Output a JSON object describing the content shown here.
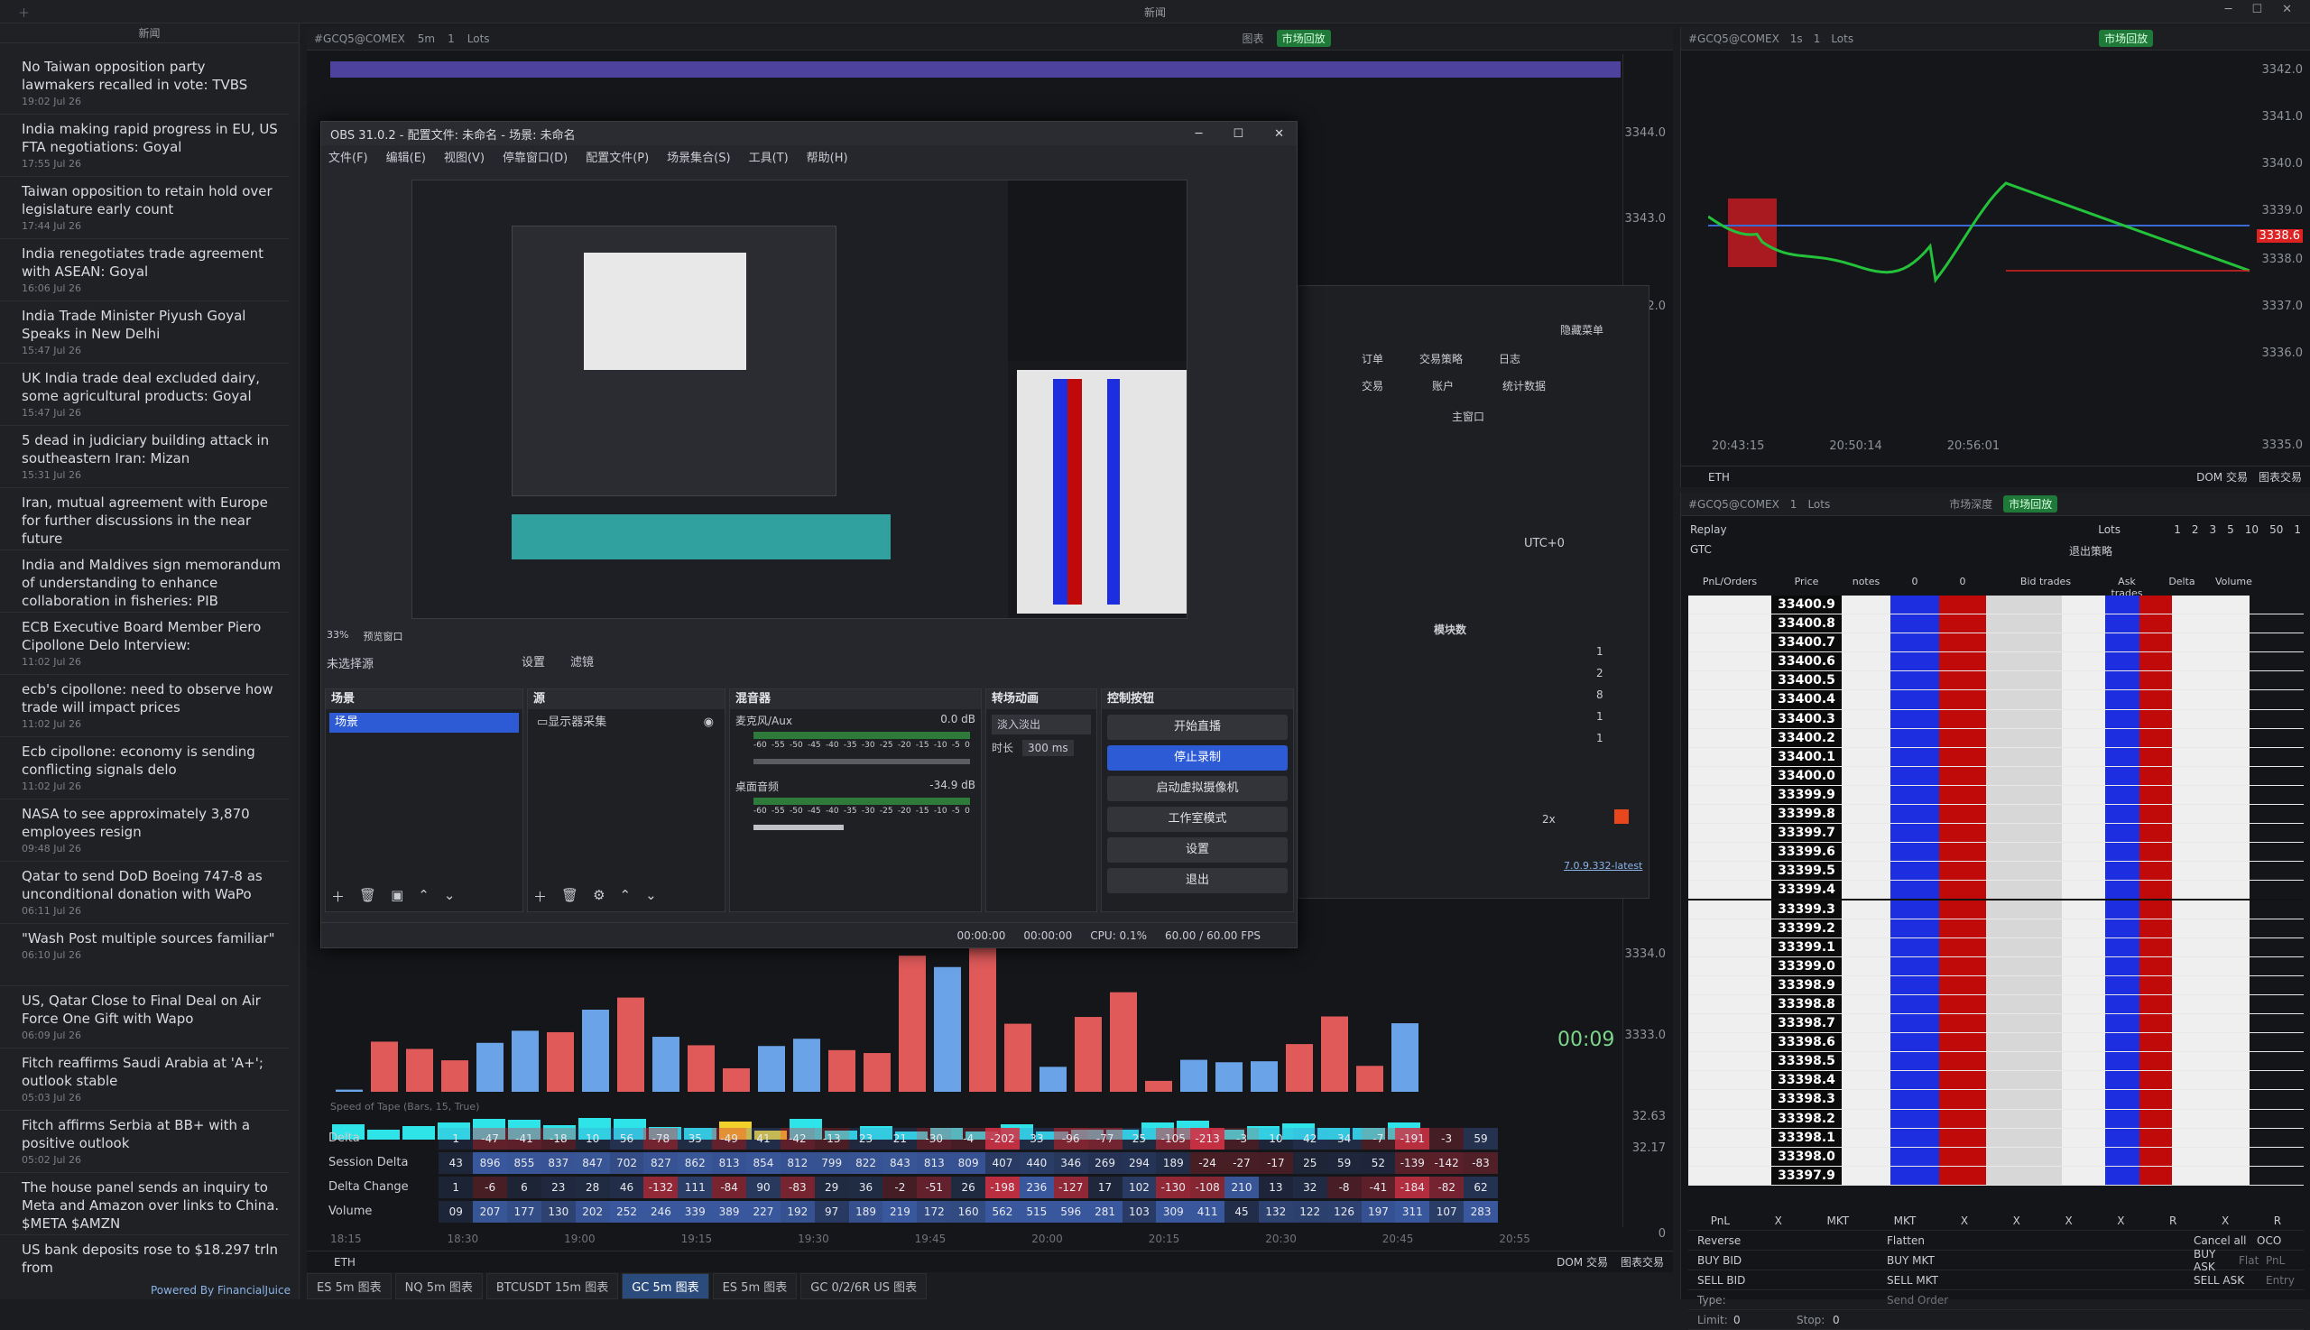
{
  "titlebar": {
    "title": "新闻"
  },
  "news": {
    "header": "新闻",
    "footer": "Powered By FinancialJuice",
    "items": [
      {
        "title": "No Taiwan opposition party lawmakers recalled in vote: TVBS",
        "time": "19:02 Jul 26"
      },
      {
        "title": "India making rapid progress in EU, US FTA negotiations: Goyal",
        "time": "17:55 Jul 26"
      },
      {
        "title": "Taiwan opposition to retain hold over legislature early count",
        "time": "17:44 Jul 26"
      },
      {
        "title": "India renegotiates trade agreement with ASEAN: Goyal",
        "time": "16:06 Jul 26"
      },
      {
        "title": "India Trade Minister Piyush Goyal Speaks in New Delhi",
        "time": "15:47 Jul 26"
      },
      {
        "title": "UK India trade deal excluded dairy, some agricultural products: Goyal",
        "time": "15:47 Jul 26"
      },
      {
        "title": "5 dead in judiciary building attack in southeastern Iran: Mizan",
        "time": "15:31 Jul 26"
      },
      {
        "title": "Iran, mutual agreement with Europe for further discussions in the near future",
        "time": "14:05 Jul 26"
      },
      {
        "title": "India and Maldives sign memorandum of understanding to enhance collaboration in fisheries: PIB",
        "time": "13:47 Jul 26"
      },
      {
        "title": "ECB Executive Board Member Piero Cipollone Delo Interview:",
        "time": "11:02 Jul 26"
      },
      {
        "title": "ecb's cipollone: need to observe how trade will impact prices",
        "time": "11:02 Jul 26"
      },
      {
        "title": "Ecb cipollone: economy is sending conflicting signals delo",
        "time": "11:02 Jul 26"
      },
      {
        "title": "NASA to see approximately 3,870 employees resign",
        "time": "09:48 Jul 26"
      },
      {
        "title": "Qatar to send DoD Boeing 747-8 as unconditional donation with WaPo",
        "time": "06:11 Jul 26"
      },
      {
        "title": "\"Wash Post multiple sources familiar\"",
        "time": "06:10 Jul 26"
      },
      {
        "title": "US, Qatar Close to Final Deal on Air Force One Gift with Wapo",
        "time": "06:09 Jul 26"
      },
      {
        "title": "Fitch reaffirms Saudi Arabia at 'A+'; outlook stable",
        "time": "05:03 Jul 26"
      },
      {
        "title": "Fitch affirms Serbia at BB+ with a positive outlook",
        "time": "05:02 Jul 26"
      },
      {
        "title": "The house panel sends an inquiry to Meta and Amazon over links to China. $META $AMZN",
        "time": "04:56 Jul 26"
      },
      {
        "title": "US bank deposits rose to $18.297 trln from",
        "time": ""
      }
    ]
  },
  "chartA": {
    "symbol": "#GCQ5@COMEX",
    "tf": "5m",
    "lots": "1",
    "lots_label": "Lots",
    "icon_label": "图表",
    "badge": "市场回放",
    "prices": [
      "3344.0",
      "3343.0",
      "3342.0",
      "3334.0",
      "3333.0",
      "32.63",
      "32.17",
      "0"
    ],
    "timer": "00:09",
    "tape_label": "Speed of Tape (Bars, 15, True)",
    "times": [
      "18:15",
      "18:30",
      "19:00",
      "19:15",
      "19:30",
      "19:45",
      "20:00",
      "20:15",
      "20:30",
      "20:45",
      "20:55"
    ],
    "bottom_left": "ETH",
    "bottom_right1": "DOM 交易",
    "bottom_right2": "图表交易"
  },
  "delta": {
    "rows": [
      {
        "label": "Delta",
        "cells": [
          "1",
          "-47",
          "-41",
          "-18",
          "10",
          "56",
          "-78",
          "35",
          "-49",
          "41",
          "-42",
          "-13",
          "23",
          "21",
          "-30",
          "-4",
          "-202",
          "33",
          "-96",
          "-77",
          "25",
          "-105",
          "-213",
          "-3",
          "10",
          "42",
          "34",
          "-7",
          "-191",
          "-3",
          "59"
        ]
      },
      {
        "label": "Session Delta",
        "cells": [
          "43",
          "896",
          "855",
          "837",
          "847",
          "702",
          "827",
          "862",
          "813",
          "854",
          "812",
          "799",
          "822",
          "843",
          "813",
          "809",
          "407",
          "440",
          "346",
          "269",
          "294",
          "189",
          "-24",
          "-27",
          "-17",
          "25",
          "59",
          "52",
          "-139",
          "-142",
          "-83"
        ]
      },
      {
        "label": "Delta Change",
        "cells": [
          "1",
          "-6",
          "6",
          "23",
          "28",
          "46",
          "-132",
          "111",
          "-84",
          "90",
          "-83",
          "29",
          "36",
          "-2",
          "-51",
          "26",
          "-198",
          "236",
          "-127",
          "17",
          "102",
          "-130",
          "-108",
          "210",
          "13",
          "32",
          "-8",
          "-41",
          "-184",
          "-82",
          "62"
        ]
      },
      {
        "label": "Volume",
        "cells": [
          "09",
          "207",
          "177",
          "130",
          "202",
          "252",
          "246",
          "339",
          "389",
          "227",
          "192",
          "97",
          "189",
          "219",
          "172",
          "160",
          "562",
          "515",
          "596",
          "281",
          "103",
          "309",
          "411",
          "45",
          "132",
          "122",
          "126",
          "197",
          "311",
          "107",
          "283"
        ]
      }
    ]
  },
  "tabs": [
    {
      "label": "ES 5m 图表"
    },
    {
      "label": "NQ 5m 图表"
    },
    {
      "label": "BTCUSDT 15m 图表"
    },
    {
      "label": "GC 5m 图表"
    },
    {
      "label": "ES 5m 图表"
    },
    {
      "label": "GC 0/2/6R US 图表"
    }
  ],
  "rightTop": {
    "symbol": "#GCQ5@COMEX",
    "tf": "1s",
    "lots": "1",
    "lots_label": "Lots",
    "badge": "市场回放",
    "prices": [
      "3342.0",
      "3341.0",
      "3340.0",
      "3339.0",
      "3338.6",
      "3338.0",
      "3337.0",
      "3336.0",
      "3335.0"
    ],
    "times": [
      "20:43:15",
      "20:50:14",
      "20:56:01"
    ],
    "eth": "ETH",
    "dom": "DOM 交易",
    "chart_trade": "图表交易"
  },
  "dom": {
    "symbol": "#GCQ5@COMEX",
    "lots": "1",
    "lots_label": "Lots",
    "depth_label": "市场深度",
    "badge": "市场回放",
    "replay": "Replay",
    "gtc": "GTC",
    "strategy": "退出策略",
    "qty": [
      "1",
      "2",
      "3",
      "5",
      "10",
      "50",
      "1"
    ],
    "qty_label": "Lots",
    "head": [
      "PnL/Orders",
      "Price",
      "notes",
      "0",
      "0",
      "Bid trades",
      "Ask trades",
      "Delta",
      "Volume"
    ],
    "prices": [
      "33400.9",
      "33400.8",
      "33400.7",
      "33400.6",
      "33400.5",
      "33400.4",
      "33400.3",
      "33400.2",
      "33400.1",
      "33400.0",
      "33399.9",
      "33399.8",
      "33399.7",
      "33399.6",
      "33399.5",
      "33399.4",
      "33399.3",
      "33399.2",
      "33399.1",
      "33399.0",
      "33398.9",
      "33398.8",
      "33398.7",
      "33398.6",
      "33398.5",
      "33398.4",
      "33398.3",
      "33398.2",
      "33398.1",
      "33398.0",
      "33397.9"
    ],
    "bottom": {
      "r0": [
        "PnL",
        "X",
        "MKT",
        "MKT",
        "X",
        "X",
        "X",
        "X",
        "R",
        "X",
        "R"
      ],
      "reverse": "Reverse",
      "flatten": "Flatten",
      "cancel_all": "Cancel all",
      "oco": "OCO",
      "buy_bid": "BUY BID",
      "buy_mkt": "BUY MKT",
      "buy_ask": "BUY ASK",
      "flat": "Flat",
      "pnl": "PnL",
      "sell_bid": "SELL BID",
      "sell_mkt": "SELL MKT",
      "sell_ask": "SELL ASK",
      "entry": "Entry",
      "type": "Type:",
      "send": "Send Order",
      "limit": "Limit:",
      "limit_val": "0",
      "stop": "Stop:",
      "stop_val": "0"
    }
  },
  "obs": {
    "title": "OBS 31.0.2 - 配置文件: 未命名 - 场景: 未命名",
    "menu": [
      "文件(F)",
      "编辑(E)",
      "视图(V)",
      "停靠窗口(D)",
      "配置文件(P)",
      "场景集合(S)",
      "工具(T)",
      "帮助(H)"
    ],
    "zoom": "33%",
    "zoom_label": "预览窗口",
    "no_source": "未选择源",
    "settings_btn": "设置",
    "filters_btn": "滤镜",
    "scenes": {
      "title": "场景",
      "item": "场景"
    },
    "sources": {
      "title": "源",
      "item": "显示器采集"
    },
    "mixer": {
      "title": "混音器",
      "ch1": "麦克风/Aux",
      "ch1_db": "0.0 dB",
      "ch2": "桌面音频",
      "ch2_db": "-34.9 dB",
      "scale": [
        "-60",
        "-55",
        "-50",
        "-45",
        "-40",
        "-35",
        "-30",
        "-25",
        "-20",
        "-15",
        "-10",
        "-5",
        "0"
      ]
    },
    "transitions": {
      "title": "转场动画",
      "type": "淡入淡出",
      "dur_label": "时长",
      "dur": "300 ms"
    },
    "controls": {
      "title": "控制按钮",
      "start_stream": "开始直播",
      "stop_record": "停止录制",
      "virtual_cam": "启动虚拟摄像机",
      "studio": "工作室模式",
      "settings": "设置",
      "exit": "退出"
    },
    "status": {
      "t1": "00:00:00",
      "t2": "00:00:00",
      "cpu": "CPU: 0.1%",
      "fps": "60.00 / 60.00 FPS"
    }
  },
  "behind": {
    "hidden_menu": "隐藏菜单",
    "order": "订单",
    "strategy": "交易策略",
    "log": "日志",
    "trade": "交易",
    "account": "账户",
    "stats": "统计数据",
    "main": "主窗口",
    "utc": "UTC+0",
    "module_count": "模块数",
    "counts": [
      "1",
      "2",
      "8",
      "1",
      "1"
    ],
    "speed": "2x",
    "version": "7.0.9.332-latest"
  }
}
